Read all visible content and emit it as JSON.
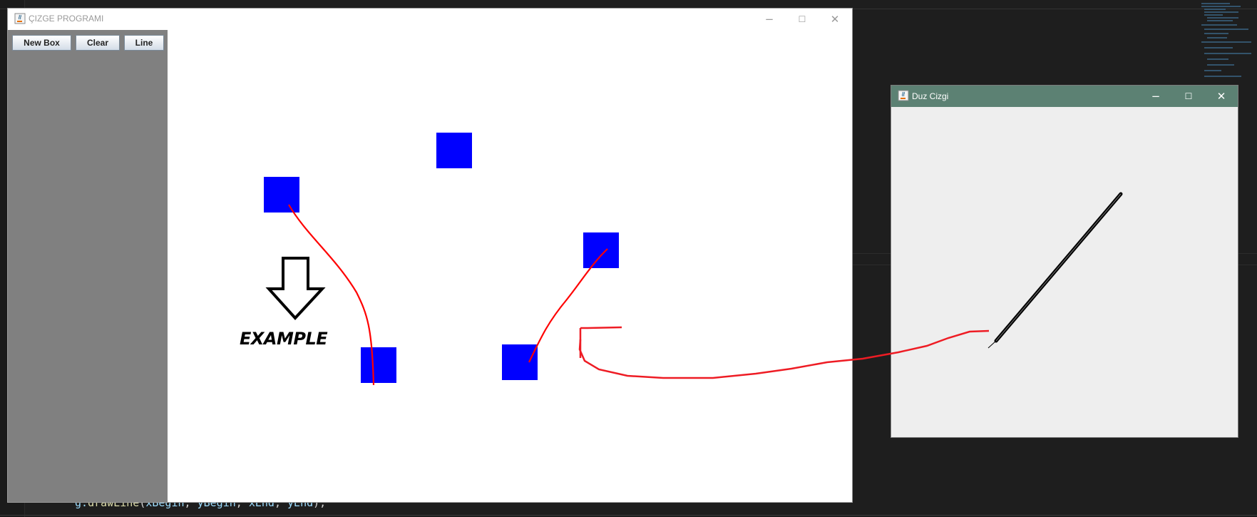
{
  "ide": {
    "code_line": {
      "method_object": "g.",
      "method": "drawLine",
      "open": "(",
      "args": [
        "xBegin",
        "yBegin",
        "xEnd",
        "yEnd"
      ],
      "close": ");"
    }
  },
  "main_window": {
    "title": "ÇIZGE PROGRAMI",
    "controls": {
      "minimize": "−",
      "maximize": "☐",
      "close": "✕"
    },
    "toolbar": {
      "new_box_label": "New Box",
      "clear_label": "Clear",
      "line_label": "Line"
    },
    "canvas": {
      "box_color": "#0000ff",
      "line_color": "#ff0000",
      "example_label": "EXAMPLE"
    }
  },
  "second_window": {
    "title": "Duz Cizgi",
    "controls": {
      "minimize": "−",
      "maximize": "☐",
      "close": "✕"
    },
    "titlebar_color": "#5c8173",
    "line_color": "#000000"
  },
  "annotation": {
    "stroke_color": "#ee1c24"
  }
}
